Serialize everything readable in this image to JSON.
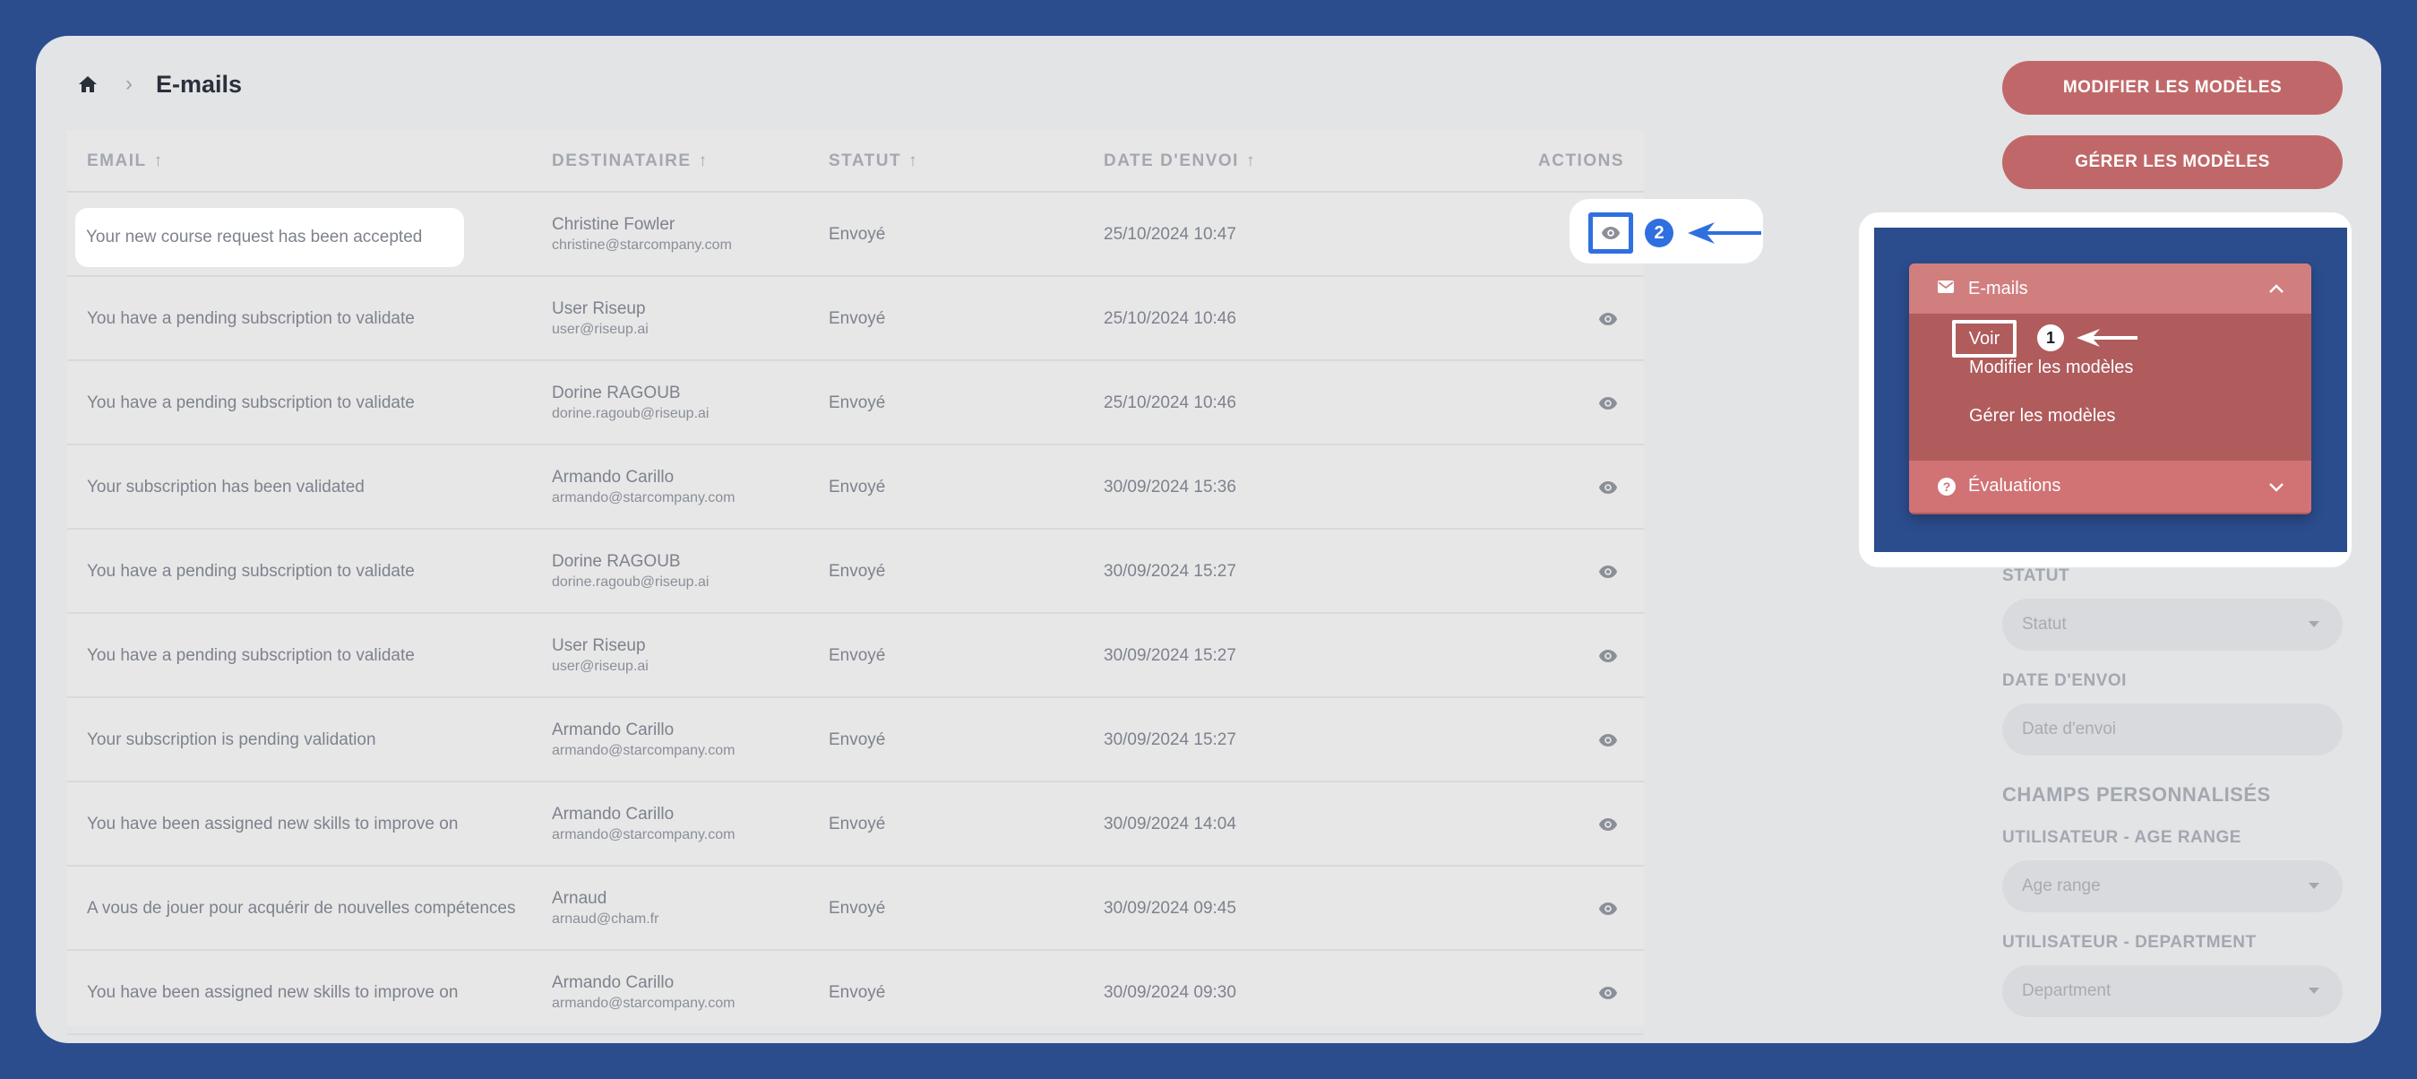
{
  "breadcrumb": {
    "title": "E-mails"
  },
  "table": {
    "headers": {
      "email": "EMAIL",
      "recipient": "DESTINATAIRE",
      "status": "STATUT",
      "date": "DATE D'ENVOI",
      "actions": "ACTIONS",
      "sort_arrow": "↑"
    },
    "rows": [
      {
        "subject": "Your new course request has been accepted",
        "name": "Christine Fowler",
        "email": "christine@starcompany.com",
        "status": "Envoyé",
        "date": "25/10/2024 10:47"
      },
      {
        "subject": "You have a pending subscription to validate",
        "name": "User Riseup",
        "email": "user@riseup.ai",
        "status": "Envoyé",
        "date": "25/10/2024 10:46"
      },
      {
        "subject": "You have a pending subscription to validate",
        "name": "Dorine RAGOUB",
        "email": "dorine.ragoub@riseup.ai",
        "status": "Envoyé",
        "date": "25/10/2024 10:46"
      },
      {
        "subject": "Your subscription has been validated",
        "name": "Armando Carillo",
        "email": "armando@starcompany.com",
        "status": "Envoyé",
        "date": "30/09/2024 15:36"
      },
      {
        "subject": "You have a pending subscription to validate",
        "name": "Dorine RAGOUB",
        "email": "dorine.ragoub@riseup.ai",
        "status": "Envoyé",
        "date": "30/09/2024 15:27"
      },
      {
        "subject": "You have a pending subscription to validate",
        "name": "User Riseup",
        "email": "user@riseup.ai",
        "status": "Envoyé",
        "date": "30/09/2024 15:27"
      },
      {
        "subject": "Your subscription is pending validation",
        "name": "Armando Carillo",
        "email": "armando@starcompany.com",
        "status": "Envoyé",
        "date": "30/09/2024 15:27"
      },
      {
        "subject": "You have been assigned new skills to improve on",
        "name": "Armando Carillo",
        "email": "armando@starcompany.com",
        "status": "Envoyé",
        "date": "30/09/2024 14:04"
      },
      {
        "subject": "A vous de jouer pour acquérir de nouvelles compétences",
        "name": "Arnaud",
        "email": "arnaud@cham.fr",
        "status": "Envoyé",
        "date": "30/09/2024 09:45"
      },
      {
        "subject": "You have been assigned new skills to improve on",
        "name": "Armando Carillo",
        "email": "armando@starcompany.com",
        "status": "Envoyé",
        "date": "30/09/2024 09:30"
      }
    ]
  },
  "buttons": {
    "modify_templates": "MODIFIER LES MODÈLES",
    "manage_templates": "GÉRER LES MODÈLES"
  },
  "filters": {
    "status_label": "STATUT",
    "status_placeholder": "Statut",
    "date_label": "DATE D'ENVOI",
    "date_placeholder": "Date d'envoi",
    "custom_section": "CHAMPS PERSONNALISÉS",
    "age_label": "UTILISATEUR - AGE RANGE",
    "age_placeholder": "Age range",
    "dept_label": "UTILISATEUR - DEPARTMENT",
    "dept_placeholder": "Department"
  },
  "menu": {
    "section": "E-mails",
    "items": [
      "Voir",
      "Modifier les modèles",
      "Gérer les modèles"
    ],
    "next_section": "Évaluations"
  },
  "steps": {
    "one": "1",
    "two": "2"
  },
  "colors": {
    "background": "#2b4d8e",
    "accent": "#c06869",
    "highlight_blue": "#2f6fe0"
  }
}
